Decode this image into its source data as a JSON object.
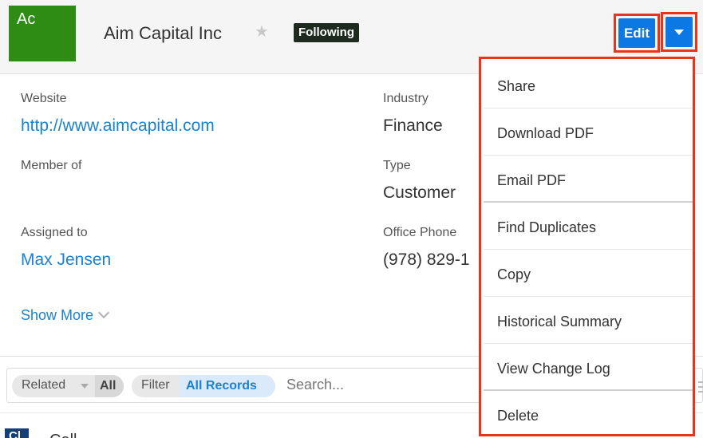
{
  "header": {
    "avatar_text": "Ac",
    "record_name": "Aim Capital Inc",
    "following_label": "Following",
    "edit_label": "Edit"
  },
  "fields": {
    "website": {
      "label": "Website",
      "value": "http://www.aimcapital.com"
    },
    "industry": {
      "label": "Industry",
      "value": "Finance"
    },
    "member_of": {
      "label": "Member of",
      "value": ""
    },
    "type": {
      "label": "Type",
      "value": "Customer"
    },
    "assigned_to": {
      "label": "Assigned to",
      "value": "Max Jensen"
    },
    "office_phone": {
      "label": "Office Phone",
      "value": "(978) 829-1"
    }
  },
  "show_more_label": "Show More",
  "toolbar": {
    "related_label": "Related",
    "related_value": "All",
    "filter_label": "Filter",
    "filter_value": "All Records",
    "search_placeholder": "Search..."
  },
  "subpanel": {
    "badge": "Cl",
    "title": "Call"
  },
  "menu": {
    "items": [
      "Share",
      "Download PDF",
      "Email PDF",
      "Find Duplicates",
      "Copy",
      "Historical Summary",
      "View Change Log",
      "Delete"
    ]
  },
  "colors": {
    "accent": "#0b78e3",
    "highlight_border": "#e8351a",
    "avatar": "#2e8b13",
    "link": "#1a82d6"
  }
}
